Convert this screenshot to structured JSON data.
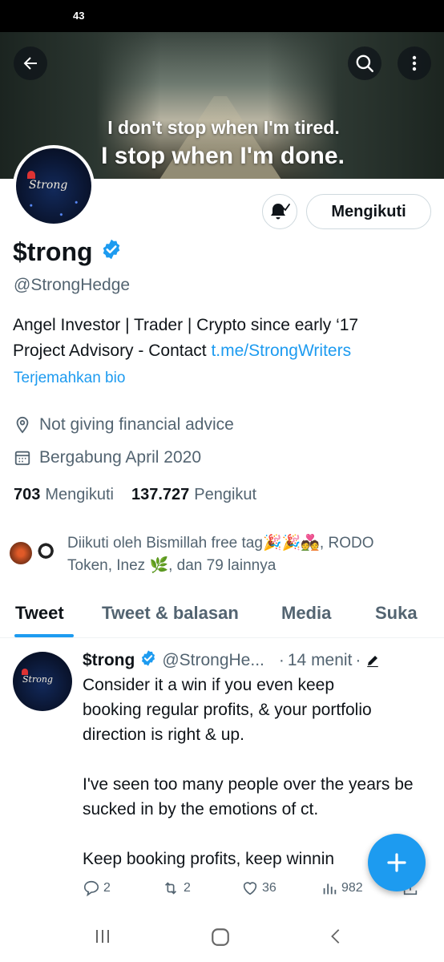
{
  "status_bar": {
    "time": "43"
  },
  "banner": {
    "quote_line1": "I don't stop when I'm tired.",
    "quote_line2": "I stop when I'm done."
  },
  "profile": {
    "display_name": "$trong",
    "handle": "@StrongHedge",
    "verified": true,
    "avatar_logo": "Strong",
    "bio_line1": "Angel Investor | Trader | Crypto since early ‘17",
    "bio_line2_prefix": "Project Advisory - Contact ",
    "bio_link": "t.me/StrongWriters",
    "translate_bio": "Terjemahkan bio",
    "location": "Not giving financial advice",
    "joined": "Bergabung April 2020",
    "following_count": "703",
    "following_label": "Mengikuti",
    "followers_count": "137.727",
    "followers_label": "Pengikut",
    "followed_by_line1": "Diikuti oleh Bismillah free tag🎉🎉💑, RODO",
    "followed_by_line2": "Token, Inez 🌿, dan 79 lainnya",
    "follow_button": "Mengikuti"
  },
  "tabs": [
    {
      "label": "Tweet",
      "active": true
    },
    {
      "label": "Tweet & balasan",
      "active": false
    },
    {
      "label": "Media",
      "active": false
    },
    {
      "label": "Suka",
      "active": false
    }
  ],
  "tweet": {
    "name": "$trong",
    "handle": "@StrongHe...",
    "time": "14 menit",
    "separator": "·",
    "paragraph1_line1": "Consider it a win if you even keep",
    "paragraph1_rest": "booking regular profits, & your portfolio direction is right & up.",
    "paragraph2": "I've seen too many people over the years be sucked in by the emotions of ct.",
    "paragraph3": "Keep booking profits, keep winnin",
    "replies": "2",
    "retweets": "2",
    "likes": "36",
    "views": "982"
  },
  "colors": {
    "accent": "#1d9bf0",
    "text_primary": "#0f1419",
    "text_secondary": "#536471"
  },
  "icons": [
    "back-arrow-icon",
    "search-icon",
    "more-vertical-icon",
    "bell-icon",
    "verified-badge-icon",
    "location-pin-icon",
    "calendar-icon",
    "edit-pencil-icon",
    "reply-icon",
    "retweet-icon",
    "like-heart-icon",
    "views-chart-icon",
    "share-icon",
    "plus-icon",
    "recent-apps-icon",
    "home-icon",
    "back-nav-icon"
  ]
}
